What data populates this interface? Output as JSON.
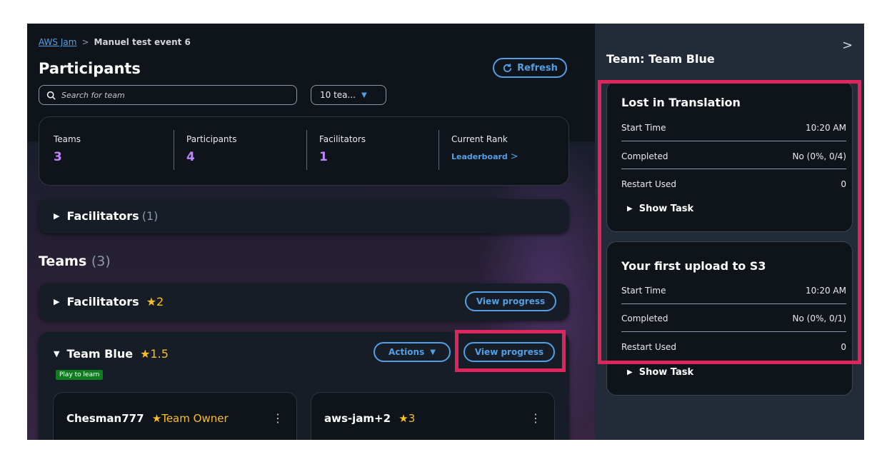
{
  "breadcrumb": {
    "root": "AWS Jam",
    "current": "Manuel test event 6"
  },
  "page": {
    "title": "Participants",
    "refresh_label": "Refresh"
  },
  "search": {
    "placeholder": "Search for team"
  },
  "team_select": {
    "value": "10 tea..."
  },
  "stats": {
    "teams_label": "Teams",
    "teams_value": "3",
    "participants_label": "Participants",
    "participants_value": "4",
    "facilitators_label": "Facilitators",
    "facilitators_value": "1",
    "rank_label": "Current Rank",
    "rank_link": "Leaderboard"
  },
  "facilitators_section": {
    "label": "Facilitators",
    "count": "(1)"
  },
  "teams_section": {
    "label": "Teams",
    "count": "(3)"
  },
  "teams": [
    {
      "name": "Facilitators",
      "score": "2",
      "view_label": "View progress"
    },
    {
      "name": "Team Blue",
      "score": "1.5",
      "actions_label": "Actions",
      "view_label": "View progress",
      "badge": "Play to learn"
    }
  ],
  "members": [
    {
      "name": "Chesman777",
      "role": "Team Owner"
    },
    {
      "name": "aws-jam+2",
      "score": "3"
    }
  ],
  "side_panel": {
    "title": "Team: Team Blue",
    "tasks": [
      {
        "title": "Lost in Translation",
        "start_label": "Start Time",
        "start_value": "10:20 AM",
        "completed_label": "Completed",
        "completed_value": "No (0%, 0/4)",
        "restart_label": "Restart Used",
        "restart_value": "0",
        "show_task": "Show Task"
      },
      {
        "title": "Your first upload to S3",
        "start_label": "Start Time",
        "start_value": "10:20 AM",
        "completed_label": "Completed",
        "completed_value": "No (0%, 0/1)",
        "restart_label": "Restart Used",
        "restart_value": "0",
        "show_task": "Show Task"
      }
    ]
  },
  "colors": {
    "accent": "#539fe5",
    "stat_value": "#c084fc",
    "star": "#fbbf24",
    "highlight": "#e0245e",
    "badge": "#0f7d1f"
  },
  "icons": [
    "search-icon",
    "refresh-icon",
    "caret-down-icon",
    "chevron-right-icon",
    "triangle-right-icon",
    "triangle-down-icon",
    "star-icon",
    "kebab-icon",
    "close-panel-icon"
  ]
}
